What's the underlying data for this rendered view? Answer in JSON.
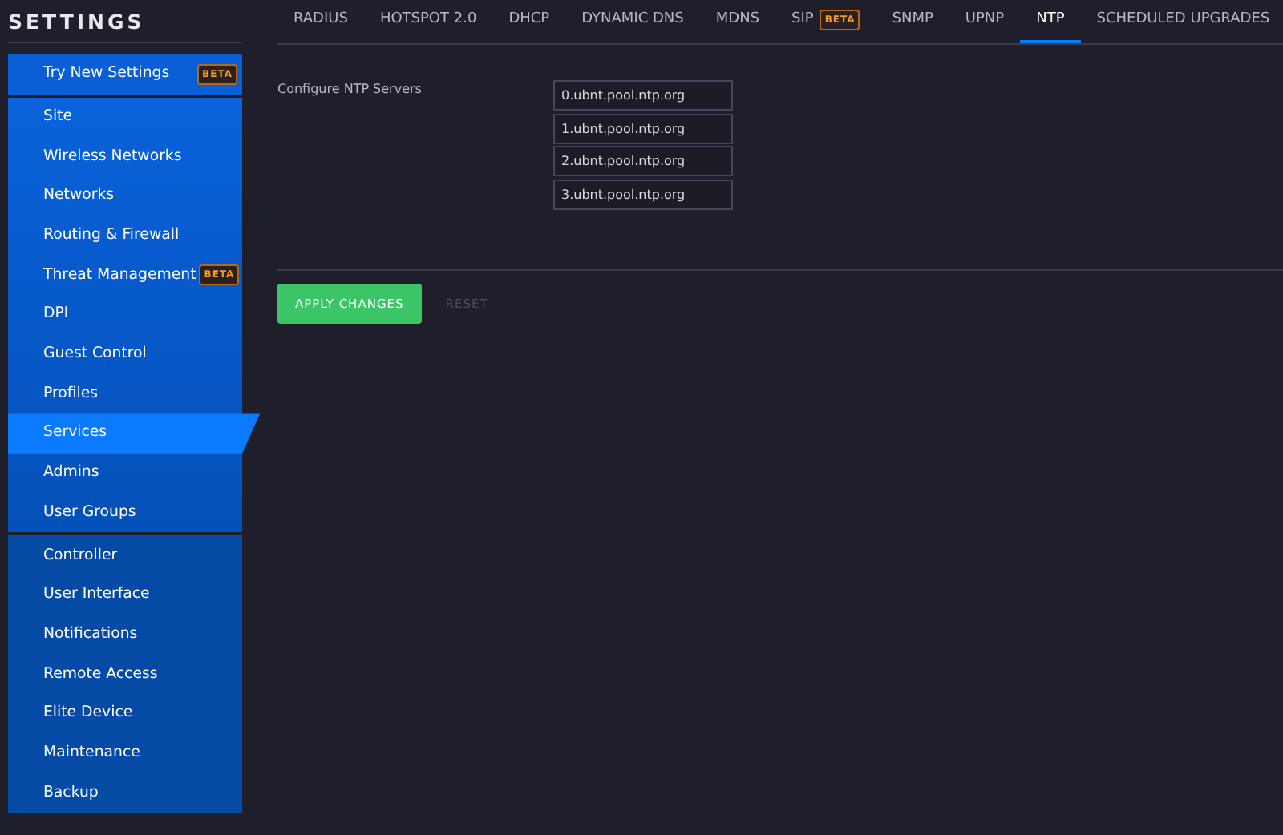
{
  "sidebar": {
    "title": "SETTINGS",
    "groups": [
      {
        "items": [
          {
            "label": "Try New Settings",
            "badge": "BETA",
            "selected": false
          }
        ]
      },
      {
        "items": [
          {
            "label": "Site",
            "selected": false
          },
          {
            "label": "Wireless Networks",
            "selected": false
          },
          {
            "label": "Networks",
            "selected": false
          },
          {
            "label": "Routing & Firewall",
            "selected": false
          },
          {
            "label": "Threat Management",
            "badge": "BETA",
            "selected": false
          },
          {
            "label": "DPI",
            "selected": false
          },
          {
            "label": "Guest Control",
            "selected": false
          },
          {
            "label": "Profiles",
            "selected": false
          },
          {
            "label": "Services",
            "selected": true
          },
          {
            "label": "Admins",
            "selected": false
          },
          {
            "label": "User Groups",
            "selected": false
          }
        ]
      },
      {
        "items": [
          {
            "label": "Controller",
            "selected": false
          },
          {
            "label": "User Interface",
            "selected": false
          },
          {
            "label": "Notifications",
            "selected": false
          },
          {
            "label": "Remote Access",
            "selected": false
          },
          {
            "label": "Elite Device",
            "selected": false
          },
          {
            "label": "Maintenance",
            "selected": false
          },
          {
            "label": "Backup",
            "selected": false
          }
        ]
      }
    ]
  },
  "tabs": [
    {
      "label": "RADIUS",
      "selected": false
    },
    {
      "label": "HOTSPOT 2.0",
      "selected": false
    },
    {
      "label": "DHCP",
      "selected": false
    },
    {
      "label": "DYNAMIC DNS",
      "selected": false
    },
    {
      "label": "MDNS",
      "selected": false
    },
    {
      "label": "SIP",
      "badge": "BETA",
      "selected": false
    },
    {
      "label": "SNMP",
      "selected": false
    },
    {
      "label": "UPNP",
      "selected": false
    },
    {
      "label": "NTP",
      "selected": true
    },
    {
      "label": "SCHEDULED UPGRADES",
      "selected": false
    }
  ],
  "form": {
    "label": "Configure NTP Servers",
    "servers": [
      "0.ubnt.pool.ntp.org",
      "1.ubnt.pool.ntp.org",
      "2.ubnt.pool.ntp.org",
      "3.ubnt.pool.ntp.org"
    ]
  },
  "buttons": [
    {
      "label": "APPLY CHANGES",
      "disabled": false
    },
    {
      "label": "RESET",
      "disabled": true
    }
  ]
}
